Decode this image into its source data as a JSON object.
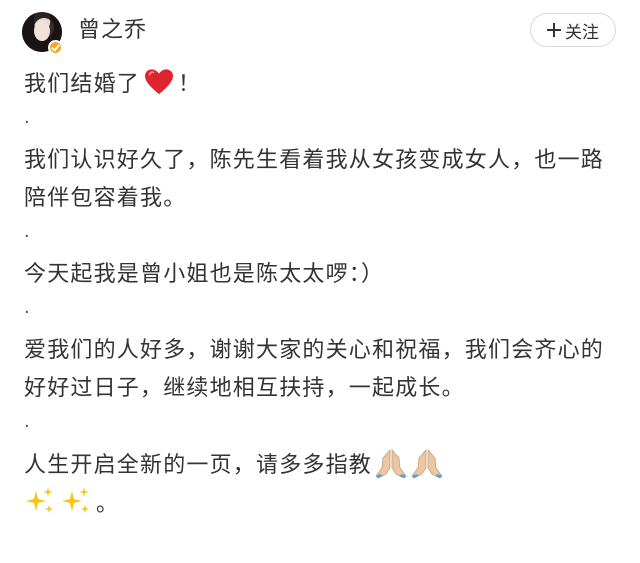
{
  "header": {
    "username": "曾之乔",
    "follow_label": "关注"
  },
  "post": {
    "line1_text": "我们结婚了",
    "line1_end": "！",
    "dot": "·",
    "line2": "我们认识好久了，陈先生看着我从女孩变成女人，也一路陪伴包容着我。",
    "line3": "今天起我是曾小姐也是陈太太啰：）",
    "line4": "爱我们的人好多，谢谢大家的关心和祝福，我们会齐心的好好过日子，继续地相互扶持，一起成长。",
    "line5": "人生开启全新的一页，请多多指教",
    "line6_end": "。"
  },
  "icons": {
    "avatar": "avatar",
    "badge": "verified-badge-icon",
    "heart": "red-heart-icon",
    "pray": "folded-hands-icon",
    "sparkles": "sparkles-icon"
  },
  "colors": {
    "heart": "#e0242f",
    "badge": "#f6a623",
    "sparkle": "#f5c518",
    "skin": "#eac6a3"
  }
}
